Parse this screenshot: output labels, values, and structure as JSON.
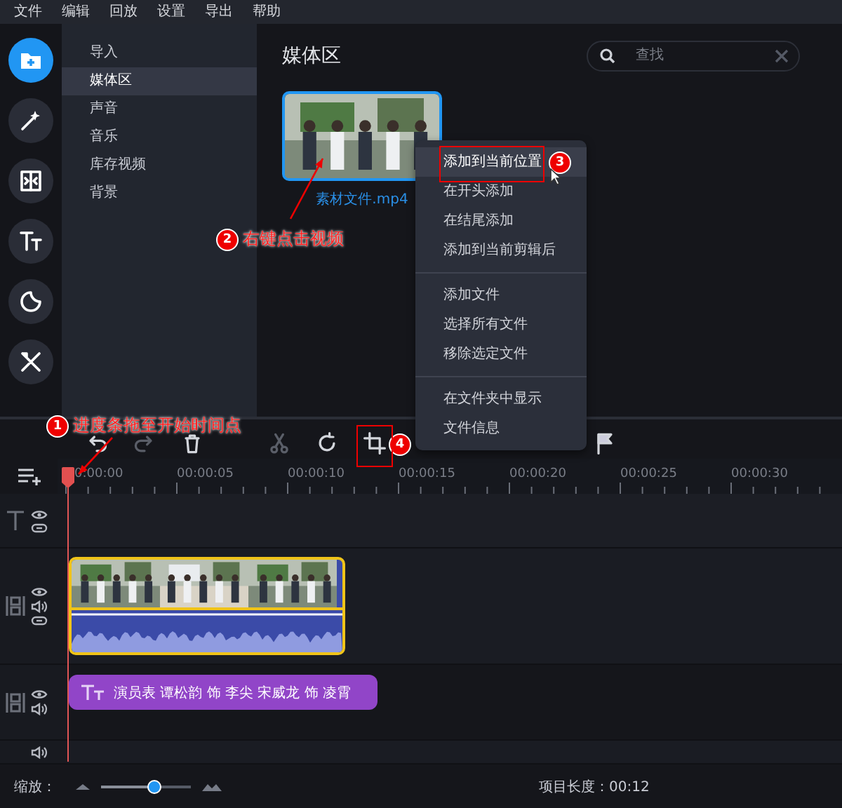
{
  "menu_bar": [
    "文件",
    "编辑",
    "回放",
    "设置",
    "导出",
    "帮助"
  ],
  "tool_rail": [
    {
      "kind": "import",
      "selected": true
    },
    {
      "kind": "wand",
      "selected": false
    },
    {
      "kind": "transition",
      "selected": false
    },
    {
      "kind": "text",
      "selected": false
    },
    {
      "kind": "sticker",
      "selected": false
    },
    {
      "kind": "tools",
      "selected": false
    }
  ],
  "nav": [
    {
      "label": "导入",
      "selected": false
    },
    {
      "label": "媒体区",
      "selected": true
    },
    {
      "label": "声音",
      "selected": false
    },
    {
      "label": "音乐",
      "selected": false
    },
    {
      "label": "库存视频",
      "selected": false
    },
    {
      "label": "背景",
      "selected": false
    }
  ],
  "media": {
    "title": "媒体区",
    "search": {
      "placeholder": "查找"
    },
    "files": [
      {
        "name": "素材文件.mp4",
        "selected": true
      }
    ]
  },
  "context_menu": [
    [
      {
        "label": "添加到当前位置",
        "highlighted": true
      },
      {
        "label": "在开头添加",
        "highlighted": false
      },
      {
        "label": "在结尾添加",
        "highlighted": false
      },
      {
        "label": "添加到当前剪辑后",
        "highlighted": false
      }
    ],
    [
      {
        "label": "添加文件",
        "highlighted": false
      },
      {
        "label": "选择所有文件",
        "highlighted": false
      },
      {
        "label": "移除选定文件",
        "highlighted": false
      }
    ],
    [
      {
        "label": "在文件夹中显示",
        "highlighted": false
      },
      {
        "label": "文件信息",
        "highlighted": false
      }
    ]
  ],
  "toolbar": [
    {
      "kind": "undo",
      "disabled": false
    },
    {
      "kind": "redo",
      "disabled": true
    },
    {
      "kind": "delete",
      "disabled": false
    },
    {
      "kind": "cut",
      "disabled": true
    },
    {
      "kind": "rotate",
      "disabled": false
    },
    {
      "kind": "crop",
      "disabled": false
    },
    {
      "kind": "flag",
      "disabled": false
    }
  ],
  "timeline": {
    "ticks": [
      "0:00:00",
      "00:00:05",
      "00:00:10",
      "00:00:15",
      "00:00:20",
      "00:00:25",
      "00:00:30"
    ],
    "tracks": [
      {
        "kind": "title"
      },
      {
        "kind": "video",
        "clip": {
          "selected": true
        }
      },
      {
        "kind": "text",
        "clip": {
          "text": "演员表 谭松韵 饰 李尖 宋威龙 饰 凌霄"
        }
      },
      {
        "kind": "audio"
      }
    ]
  },
  "status": {
    "zoom_label": "缩放：",
    "zoom": {
      "level": 0.6
    },
    "length": "项目长度：00:12"
  },
  "annotations": [
    {
      "number": "1",
      "text": "进度条拖至开始时间点",
      "arrow": true,
      "boxed": false
    },
    {
      "number": "2",
      "text": "右键点击视频",
      "arrow": true,
      "boxed": false
    },
    {
      "number": "3",
      "arrow": false,
      "boxed": true
    },
    {
      "number": "4",
      "arrow": false,
      "boxed": true
    }
  ]
}
